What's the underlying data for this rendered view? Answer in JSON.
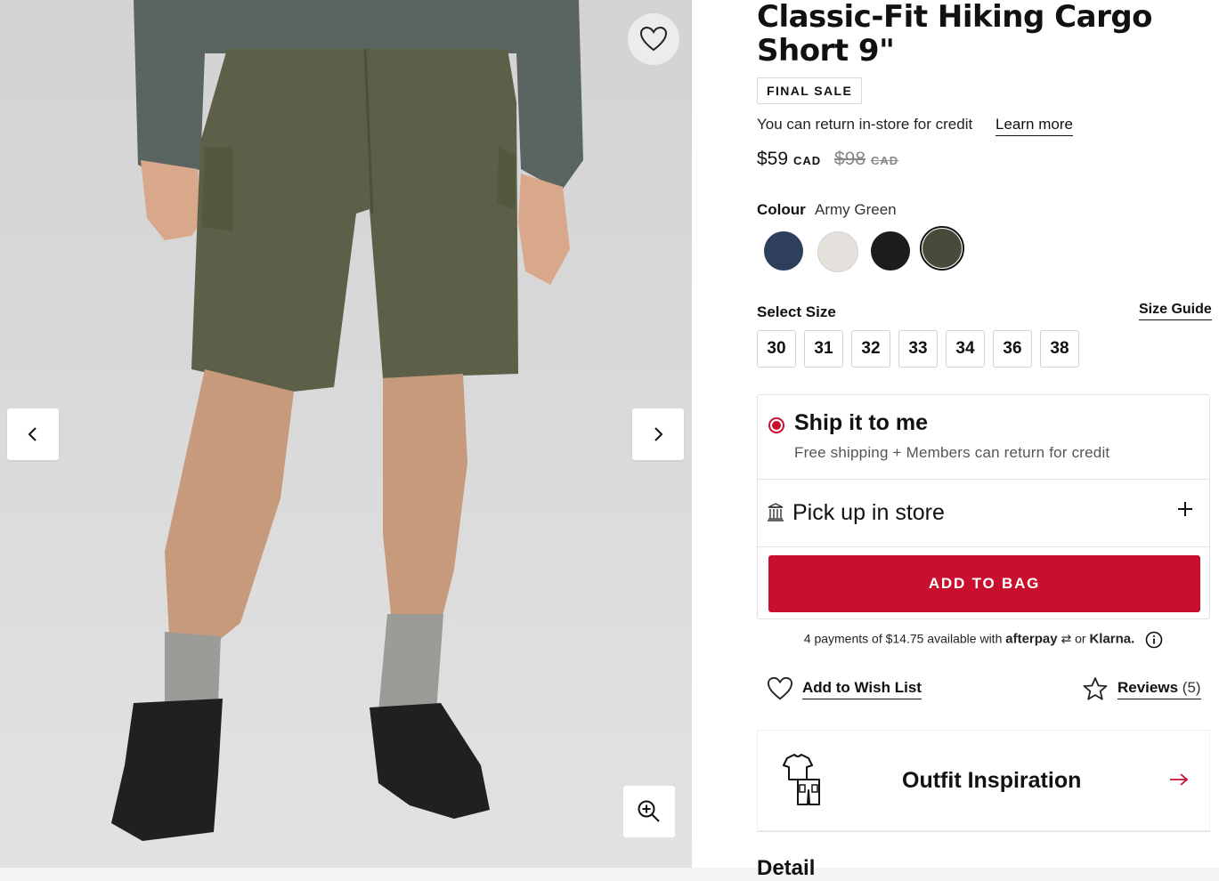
{
  "product": {
    "title": "Classic-Fit Hiking Cargo Short 9\"",
    "badge": "FINAL SALE",
    "return_note": "You can return in-store for credit",
    "learn_more": "Learn more",
    "price_now": "$59",
    "price_now_currency": "CAD",
    "price_was": "$98",
    "price_was_currency": "CAD"
  },
  "colour": {
    "label": "Colour",
    "selected": "Army Green",
    "swatches": [
      {
        "name": "navy",
        "hex": "#2e3f5c"
      },
      {
        "name": "bone",
        "hex": "#e5e2dd"
      },
      {
        "name": "black",
        "hex": "#1c1c1c"
      },
      {
        "name": "army-green",
        "hex": "#4a4a3a"
      }
    ]
  },
  "size": {
    "label": "Select Size",
    "guide": "Size Guide",
    "options": [
      "30",
      "31",
      "32",
      "33",
      "34",
      "36",
      "38"
    ]
  },
  "fulfilment": {
    "ship_title": "Ship it to me",
    "ship_sub": "Free shipping + Members can return for credit",
    "pickup_label": "Pick up in store"
  },
  "cta": {
    "add_to_bag": "ADD TO BAG",
    "color": "#c8102e"
  },
  "payments": {
    "text": "4 payments of $14.75 available with",
    "afterpay": "afterpay",
    "or": "or",
    "klarna": "Klarna."
  },
  "actions": {
    "wish_list": "Add to Wish List",
    "reviews": "Reviews",
    "reviews_count": "(5)"
  },
  "outfit": {
    "label": "Outfit Inspiration"
  },
  "details_peek": "Detail"
}
